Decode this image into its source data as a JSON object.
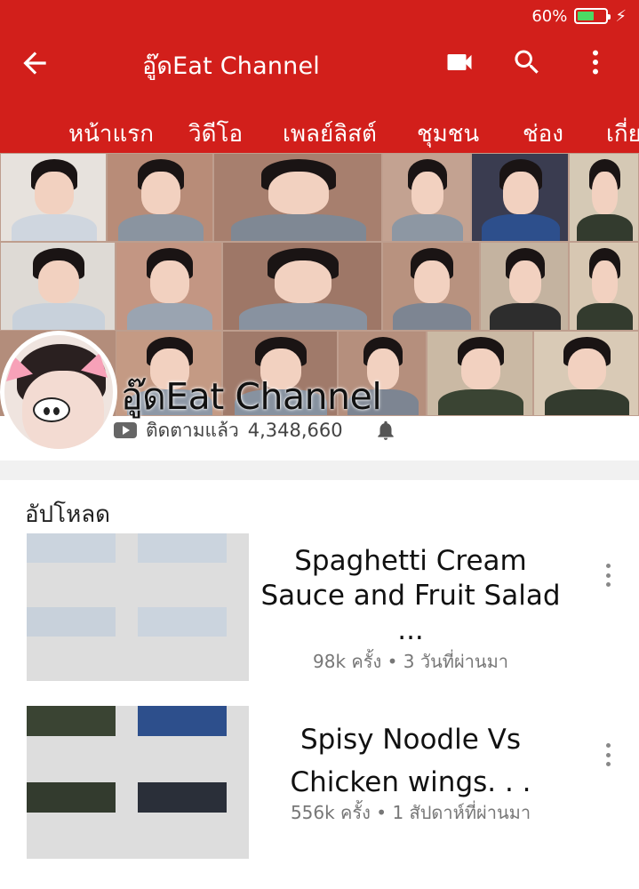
{
  "status_bar": {
    "battery_percent": "60%",
    "battery_level": 0.6,
    "battery_color": "#4cd964"
  },
  "app_bar": {
    "title": "อู๊ดEat Channel",
    "back_icon": "arrow-left-icon",
    "camera_icon": "video-camera-icon",
    "search_icon": "search-icon",
    "menu_icon": "more-vert-icon",
    "background_color": "#d21f1b"
  },
  "tabs": [
    {
      "label": "หน้าแรก"
    },
    {
      "label": "วิดีโอ"
    },
    {
      "label": "เพลย์ลิสต์"
    },
    {
      "label": "ชุมชน"
    },
    {
      "label": "ช่อง"
    },
    {
      "label": "เกี่ย"
    }
  ],
  "channel": {
    "name": "อู๊ดEat Channel",
    "subscribed_label": "ติดตามแล้ว",
    "subscriber_count": "4,348,660",
    "bell_icon": "bell-icon",
    "subscribe_icon": "youtube-icon"
  },
  "uploads": {
    "section_title": "อัปโหลด",
    "videos": [
      {
        "title": "Spaghetti Cream Sauce and Fruit Salad ...",
        "meta": "98k ครั้ง • 3 วันที่ผ่านมา"
      },
      {
        "title": "Spisy Noodle Vs Chicken wings. . .",
        "meta": "556k ครั้ง • 1 สัปดาห์ที่ผ่านมา"
      }
    ]
  }
}
